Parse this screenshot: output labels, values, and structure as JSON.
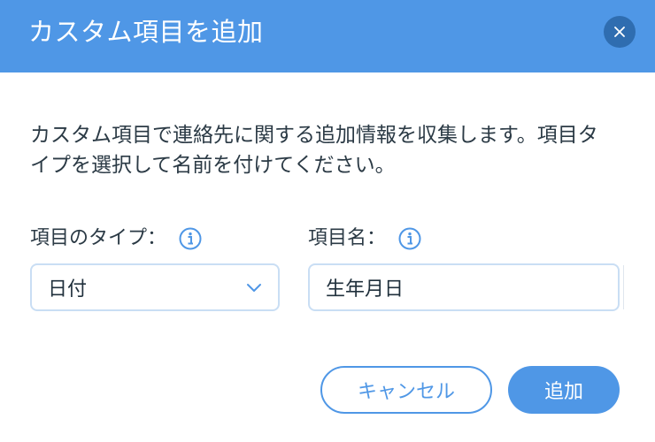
{
  "dialog": {
    "title": "カスタム項目を追加",
    "description": "カスタム項目で連絡先に関する追加情報を収集します。項目タイプを選択して名前を付けてください。"
  },
  "fields": {
    "type_label": "項目のタイプ：",
    "type_value": "日付",
    "name_label": "項目名：",
    "name_value": "生年月日"
  },
  "buttons": {
    "cancel_label": "キャンセル",
    "add_label": "追加"
  },
  "icons": {
    "close": "close-icon",
    "info": "info-icon",
    "dropdown": "chevron-down-icon"
  },
  "colors": {
    "accent": "#4f97e6",
    "close_bg": "#2f6db0",
    "border": "#c9def4"
  }
}
